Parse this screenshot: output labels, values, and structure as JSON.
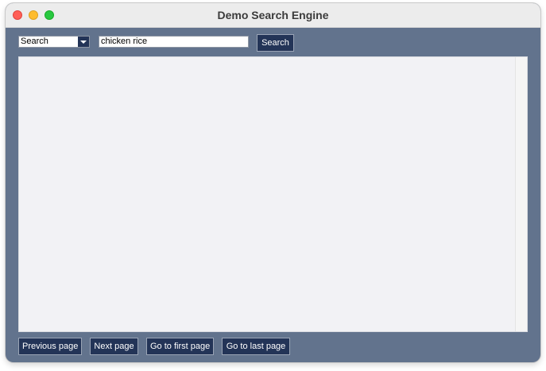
{
  "window": {
    "title": "Demo Search Engine"
  },
  "search_bar": {
    "mode_selected": "Search",
    "query_value": "chicken rice",
    "search_button_label": "Search"
  },
  "pagination": {
    "previous_label": "Previous page",
    "next_label": "Next page",
    "first_label": "Go to first page",
    "last_label": "Go to last page"
  },
  "icons": {
    "dropdown": "chevron-down-icon",
    "close": "traffic-light-close",
    "minimize": "traffic-light-minimize",
    "zoom": "traffic-light-zoom"
  },
  "colors": {
    "window_background": "#62738d",
    "button_background": "#233457",
    "results_background": "#f2f2f5",
    "close": "#ff5f57",
    "minimize": "#febc2e",
    "zoom": "#28c840"
  }
}
